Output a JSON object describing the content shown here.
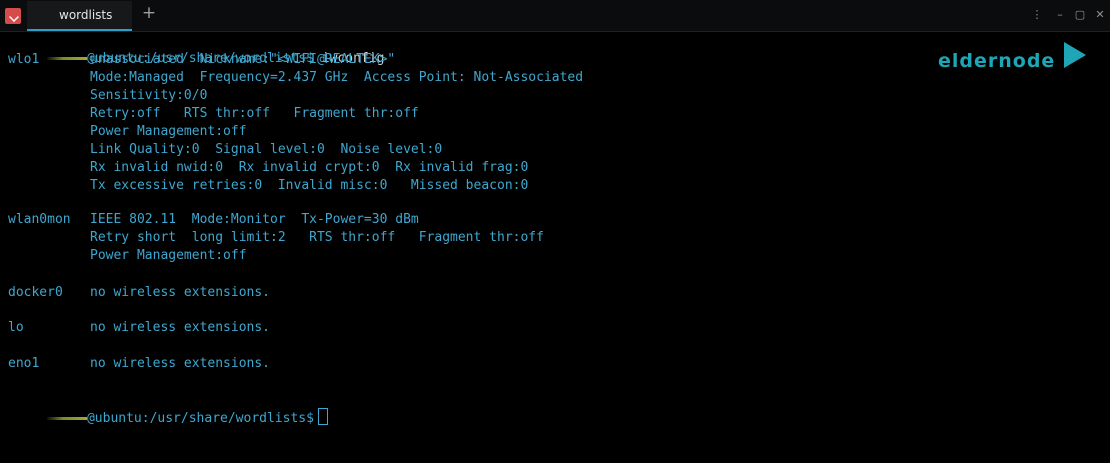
{
  "window": {
    "tab_title": "wordlists",
    "new_tab_symbol": "+",
    "controls": {
      "menu": "⋮",
      "minimize": "–",
      "maximize": "▢",
      "close": "✕"
    }
  },
  "watermark": {
    "text": "eldernode"
  },
  "terminal": {
    "prompt1": {
      "host_path": "@ubuntu:/usr/share/wordlists$",
      "command": " iwconfig"
    },
    "interfaces": [
      {
        "name": "wlo1",
        "lines": [
          "unassociated  Nickname:\"<WIFI@REALTEK>\"",
          "Mode:Managed  Frequency=2.437 GHz  Access Point: Not-Associated",
          "Sensitivity:0/0",
          "Retry:off   RTS thr:off   Fragment thr:off",
          "Power Management:off",
          "Link Quality:0  Signal level:0  Noise level:0",
          "Rx invalid nwid:0  Rx invalid crypt:0  Rx invalid frag:0",
          "Tx excessive retries:0  Invalid misc:0   Missed beacon:0"
        ]
      },
      {
        "name": "wlan0mon",
        "lines": [
          "IEEE 802.11  Mode:Monitor  Tx-Power=30 dBm",
          "Retry short  long limit:2   RTS thr:off   Fragment thr:off",
          "Power Management:off"
        ]
      },
      {
        "name": "docker0",
        "lines": [
          "no wireless extensions."
        ]
      },
      {
        "name": "lo",
        "lines": [
          "no wireless extensions."
        ]
      },
      {
        "name": "eno1",
        "lines": [
          "no wireless extensions."
        ]
      }
    ],
    "prompt2": {
      "host_path": "@ubuntu:/usr/share/wordlists$"
    }
  },
  "colors": {
    "terminal_text": "#3fa7cf",
    "background": "#000000",
    "watermark": "#1ea6b6"
  }
}
